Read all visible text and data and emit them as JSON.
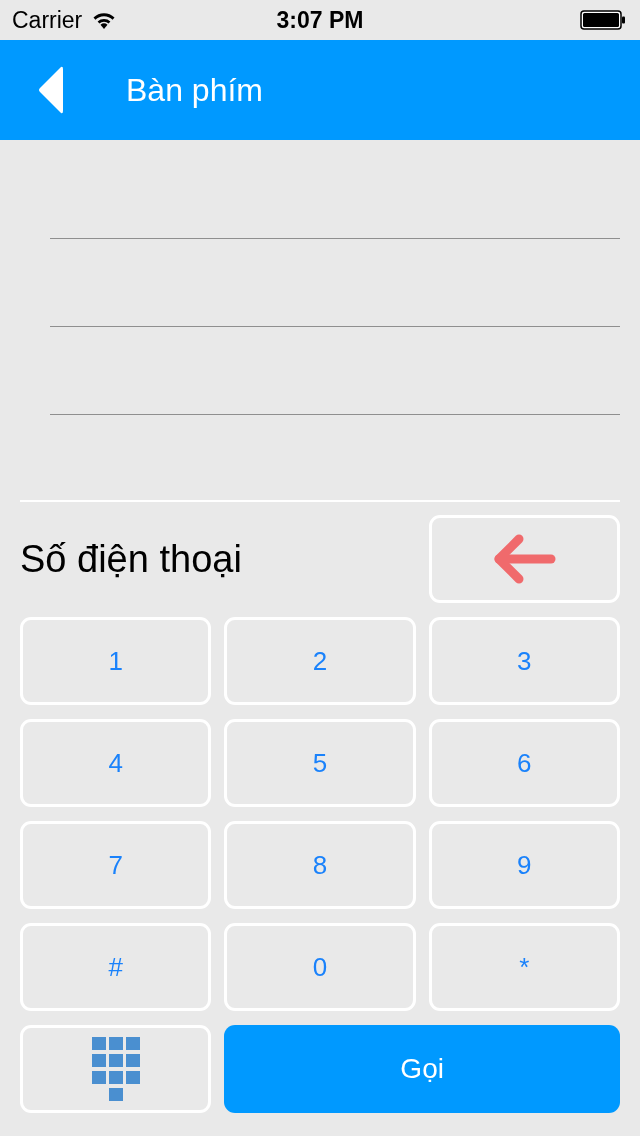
{
  "status_bar": {
    "carrier": "Carrier",
    "time": "3:07 PM"
  },
  "nav_bar": {
    "title": "Bàn phím"
  },
  "number_label": "Số điện thoại",
  "keys": [
    "1",
    "2",
    "3",
    "4",
    "5",
    "6",
    "7",
    "8",
    "9",
    "#",
    "0",
    "*"
  ],
  "call_button": {
    "label": "Gọi"
  }
}
